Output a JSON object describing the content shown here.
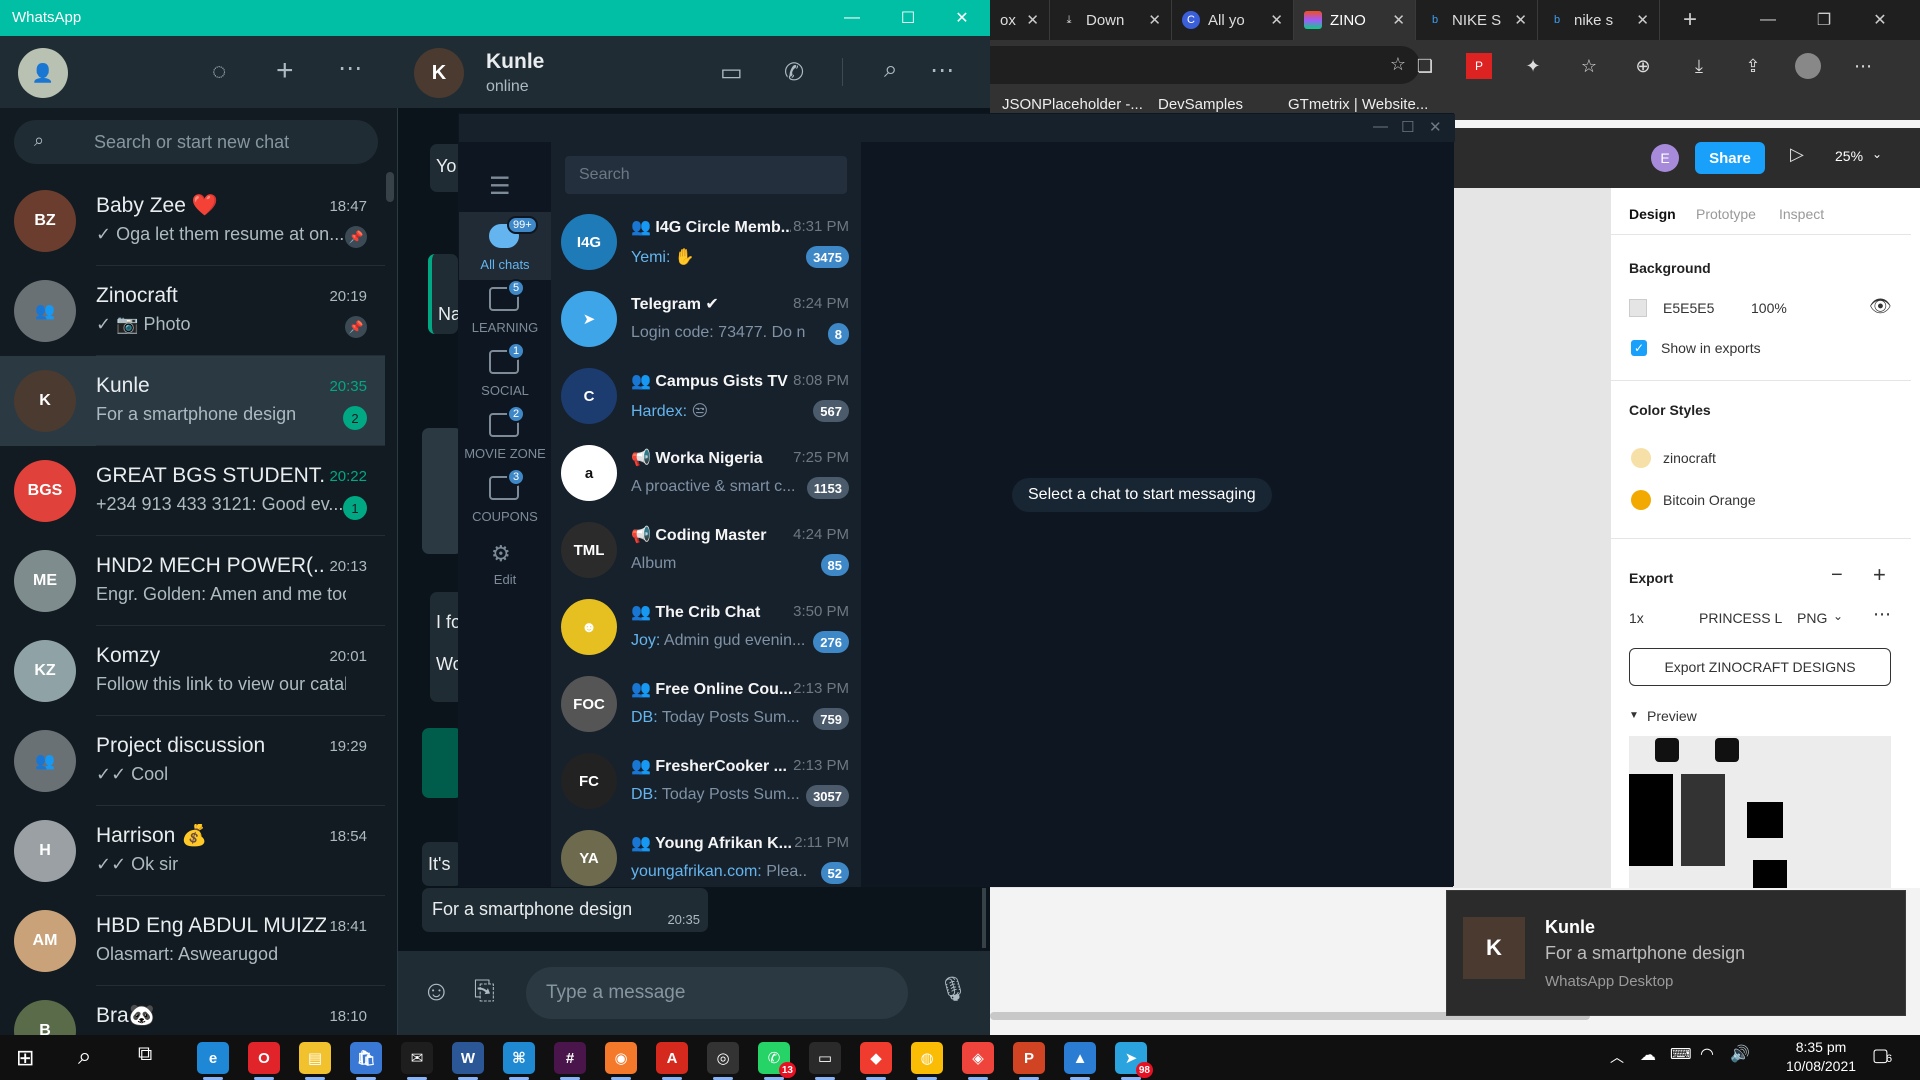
{
  "browser": {
    "tabs": [
      {
        "label": "ox",
        "icon": "inbox-icon"
      },
      {
        "label": "Down",
        "icon": "download-icon"
      },
      {
        "label": "All yo",
        "icon": "canva-icon"
      },
      {
        "label": "ZINO",
        "icon": "figma-icon",
        "active": true
      },
      {
        "label": "NIKE S",
        "icon": "bing-icon"
      },
      {
        "label": "nike s",
        "icon": "bing-icon"
      }
    ],
    "bookmarks": [
      "JSONPlaceholder -...",
      "DevSamples",
      "GTmetrix | Website..."
    ]
  },
  "figma": {
    "user_initial": "E",
    "share_label": "Share",
    "zoom": "25%",
    "panel_tabs": [
      "Design",
      "Prototype",
      "Inspect"
    ],
    "background_title": "Background",
    "background_hex": "E5E5E5",
    "background_opacity": "100%",
    "show_in_exports": "Show in exports",
    "color_styles_title": "Color Styles",
    "color_styles": [
      {
        "name": "zinocraft",
        "color": "#f6e0a8"
      },
      {
        "name": "Bitcoin Orange",
        "color": "#f2a900"
      }
    ],
    "export_title": "Export",
    "export_scale": "1x",
    "export_suffix": "PRINCESS L",
    "export_format": "PNG",
    "export_button": "Export ZINOCRAFT DESIGNS",
    "preview_label": "Preview"
  },
  "whatsapp": {
    "window_title": "WhatsApp",
    "search_placeholder": "Search or start new chat",
    "chats": [
      {
        "name": "Baby Zee ❤️",
        "preview": "✓ Oga let them resume at on...",
        "time": "18:47",
        "pinned": true,
        "avatar_color": "#6b3d2e",
        "initials": "BZ"
      },
      {
        "name": "Zinocraft",
        "preview": "✓ 📷 Photo",
        "time": "20:19",
        "pinned": true,
        "avatar_color": "#6a7175",
        "initials": "👥"
      },
      {
        "name": "Kunle",
        "preview": "For a smartphone design",
        "time": "20:35",
        "badge": "2",
        "selected": true,
        "avatar_color": "#4a3a30",
        "initials": "K"
      },
      {
        "name": "GREAT BGS STUDENT...",
        "preview": "+234 913 433 3121: Good ev...",
        "time": "20:22",
        "badge": "1",
        "avatar_color": "#e0413a",
        "initials": "BGS"
      },
      {
        "name": "HND2 MECH POWER(...",
        "preview": "Engr. Golden: Amen and me too",
        "time": "20:13",
        "avatar_color": "#7f8c8d",
        "initials": "ME"
      },
      {
        "name": "Komzy",
        "preview": "Follow this link to view our catal...",
        "time": "20:01",
        "avatar_color": "#8fa3a6",
        "initials": "KZ"
      },
      {
        "name": "Project discussion",
        "preview": "✓✓ Cool",
        "time": "19:29",
        "avatar_color": "#6a7175",
        "initials": "👥"
      },
      {
        "name": "Harrison 💰",
        "preview": "✓✓ Ok sir",
        "time": "18:54",
        "avatar_color": "#9aa0a3",
        "initials": "H"
      },
      {
        "name": "HBD Eng ABDUL MUIZZ",
        "preview": "Olasmart: Aswearugod",
        "time": "18:41",
        "avatar_color": "#c9a27a",
        "initials": "AM"
      },
      {
        "name": "Bra🐼",
        "preview": "",
        "time": "18:10",
        "avatar_color": "#5a6b4a",
        "initials": "B"
      }
    ],
    "conversation": {
      "name": "Kunle",
      "status": "online",
      "partial_texts": [
        "Yo",
        "Na",
        "I fo",
        "Wo",
        "It's"
      ],
      "last_message": "For a smartphone design",
      "last_time": "20:35",
      "input_placeholder": "Type a message"
    }
  },
  "telegram": {
    "search_placeholder": "Search",
    "folders": [
      {
        "label": "All chats",
        "badge": "99+",
        "selected": true
      },
      {
        "label": "LEARNING",
        "badge": "5"
      },
      {
        "label": "SOCIAL",
        "badge": "1"
      },
      {
        "label": "MOVIE ZONE",
        "badge": "2"
      },
      {
        "label": "COUPONS",
        "badge": "3"
      },
      {
        "label": "Edit",
        "badge": ""
      }
    ],
    "chats": [
      {
        "name": "I4G Circle Memb...",
        "time": "8:31 PM",
        "who": "Yemi: ",
        "preview": "✋",
        "badge": "3475",
        "blue": true,
        "group": true,
        "avatar": "I4G",
        "color": "#1e7bb8"
      },
      {
        "name": "Telegram ✔",
        "time": "8:24 PM",
        "who": "",
        "preview": "Login code: 73477. Do n...",
        "badge": "8",
        "blue": true,
        "group": false,
        "avatar": "➤",
        "color": "#3ea6e8"
      },
      {
        "name": "Campus Gists TV",
        "time": "8:08 PM",
        "who": "Hardex: ",
        "preview": "😒",
        "badge": "567",
        "blue": false,
        "group": true,
        "avatar": "C",
        "color": "#1c3b6e"
      },
      {
        "name": "Worka Nigeria",
        "time": "7:25 PM",
        "who": "",
        "preview": "A proactive & smart c...",
        "badge": "1153",
        "blue": false,
        "channel": true,
        "avatar": "a",
        "color": "#ffffff"
      },
      {
        "name": "Coding Master",
        "time": "4:24 PM",
        "who": "",
        "preview": "Album",
        "badge": "85",
        "blue": true,
        "channel": true,
        "avatar": "TML",
        "color": "#2b2b2b"
      },
      {
        "name": "The Crib Chat",
        "time": "3:50 PM",
        "who": "Joy: ",
        "preview": "Admin gud evenin...",
        "badge": "276",
        "blue": true,
        "group": true,
        "avatar": "☻",
        "color": "#e6c020"
      },
      {
        "name": "Free Online Cou...",
        "time": "2:13 PM",
        "who": "DB: ",
        "preview": "Today Posts Sum...",
        "badge": "759",
        "blue": false,
        "group": true,
        "avatar": "FOC",
        "color": "#555"
      },
      {
        "name": "FresherCooker ...",
        "time": "2:13 PM",
        "who": "DB: ",
        "preview": "Today Posts Sum...",
        "badge": "3057",
        "blue": false,
        "group": true,
        "avatar": "FC",
        "color": "#222"
      },
      {
        "name": "Young Afrikan K...",
        "time": "2:11 PM",
        "who": "youngafrikan.com: ",
        "preview": "Plea...",
        "badge": "52",
        "blue": true,
        "group": true,
        "avatar": "YA",
        "color": "#6e6a4e"
      }
    ],
    "empty_state": "Select a chat to start messaging"
  },
  "toast": {
    "title": "Kunle",
    "body": "For a smartphone design",
    "app": "WhatsApp Desktop"
  },
  "taskbar": {
    "apps": [
      {
        "name": "edge-icon",
        "color": "#1e88d6",
        "glyph": "e"
      },
      {
        "name": "opera-icon",
        "color": "#e0242a",
        "glyph": "O"
      },
      {
        "name": "file-explorer-icon",
        "color": "#f2c12e",
        "glyph": "▤"
      },
      {
        "name": "store-icon",
        "color": "#3a78d6",
        "glyph": "🛍"
      },
      {
        "name": "mail-icon",
        "color": "#1e1e1e",
        "glyph": "✉"
      },
      {
        "name": "word-icon",
        "color": "#2b5797",
        "glyph": "W"
      },
      {
        "name": "vscode-icon",
        "color": "#1f8ad2",
        "glyph": "⌘"
      },
      {
        "name": "slack-icon",
        "color": "#4a154b",
        "glyph": "#"
      },
      {
        "name": "blender-icon",
        "color": "#f5792a",
        "glyph": "◉"
      },
      {
        "name": "acrobat-icon",
        "color": "#d5291e",
        "glyph": "A"
      },
      {
        "name": "media-player-icon",
        "color": "#333",
        "glyph": "◎"
      },
      {
        "name": "whatsapp-icon",
        "color": "#25d366",
        "glyph": "✆",
        "badge": "13"
      },
      {
        "name": "terminal-icon",
        "color": "#2a2a2a",
        "glyph": "▭"
      },
      {
        "name": "git-icon",
        "color": "#f03c2e",
        "glyph": "◆"
      },
      {
        "name": "chrome-icon",
        "color": "#fbbc05",
        "glyph": "◍"
      },
      {
        "name": "anydesk-icon",
        "color": "#ef443b",
        "glyph": "◈"
      },
      {
        "name": "powerpoint-icon",
        "color": "#d04423",
        "glyph": "P"
      },
      {
        "name": "photos-icon",
        "color": "#2b7cd3",
        "glyph": "▲"
      },
      {
        "name": "telegram-icon",
        "color": "#2aa3de",
        "glyph": "➤",
        "badge": "98"
      }
    ],
    "time": "8:35 pm",
    "date": "10/08/2021",
    "notification_count": "6"
  }
}
